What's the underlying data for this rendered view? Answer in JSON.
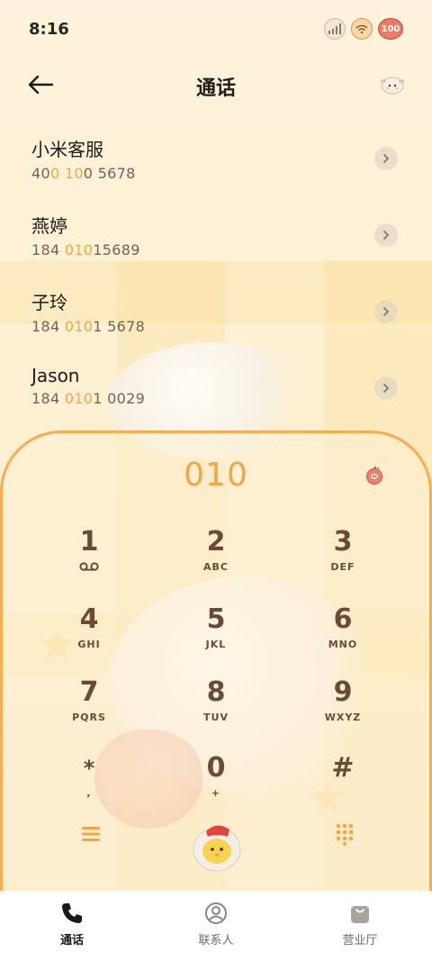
{
  "status_bar": {
    "time": "8:16",
    "battery_level": "100",
    "icons": [
      "signal-icon",
      "wifi-icon",
      "battery-icon"
    ]
  },
  "header": {
    "title": "通话",
    "back_icon": "arrow-left-icon",
    "theme_icon": "sheep-icon"
  },
  "recent_calls": [
    {
      "name": "小米客服",
      "number_pre": "40",
      "number_hl1": "0 10",
      "number_post": "0 5678"
    },
    {
      "name": "燕婷",
      "number_pre": "184 ",
      "number_hl1": "010",
      "number_post": "15689"
    },
    {
      "name": "子玲",
      "number_pre": "184 ",
      "number_hl1": "010",
      "number_post": "1 5678"
    },
    {
      "name": "Jason",
      "number_pre": "184 ",
      "number_hl1": "010",
      "number_post": "1 0029"
    }
  ],
  "dialer": {
    "display": "010",
    "keys": [
      {
        "digit": "1",
        "letters": ""
      },
      {
        "digit": "2",
        "letters": "ABC"
      },
      {
        "digit": "3",
        "letters": "DEF"
      },
      {
        "digit": "4",
        "letters": "GHI"
      },
      {
        "digit": "5",
        "letters": "JKL"
      },
      {
        "digit": "6",
        "letters": "MNO"
      },
      {
        "digit": "7",
        "letters": "PQRS"
      },
      {
        "digit": "8",
        "letters": "TUV"
      },
      {
        "digit": "9",
        "letters": "WXYZ"
      },
      {
        "digit": "*",
        "letters": ","
      },
      {
        "digit": "0",
        "letters": "+"
      },
      {
        "digit": "#",
        "letters": ""
      }
    ]
  },
  "bottom_nav": [
    {
      "label": "通话",
      "icon": "phone-icon",
      "active": true
    },
    {
      "label": "联系人",
      "icon": "contact-icon",
      "active": false
    },
    {
      "label": "营业厅",
      "icon": "store-bag-icon",
      "active": false
    }
  ],
  "colors": {
    "accent": "#f3a544",
    "key_text": "#6b4a36",
    "background": "#fdf3dc"
  }
}
